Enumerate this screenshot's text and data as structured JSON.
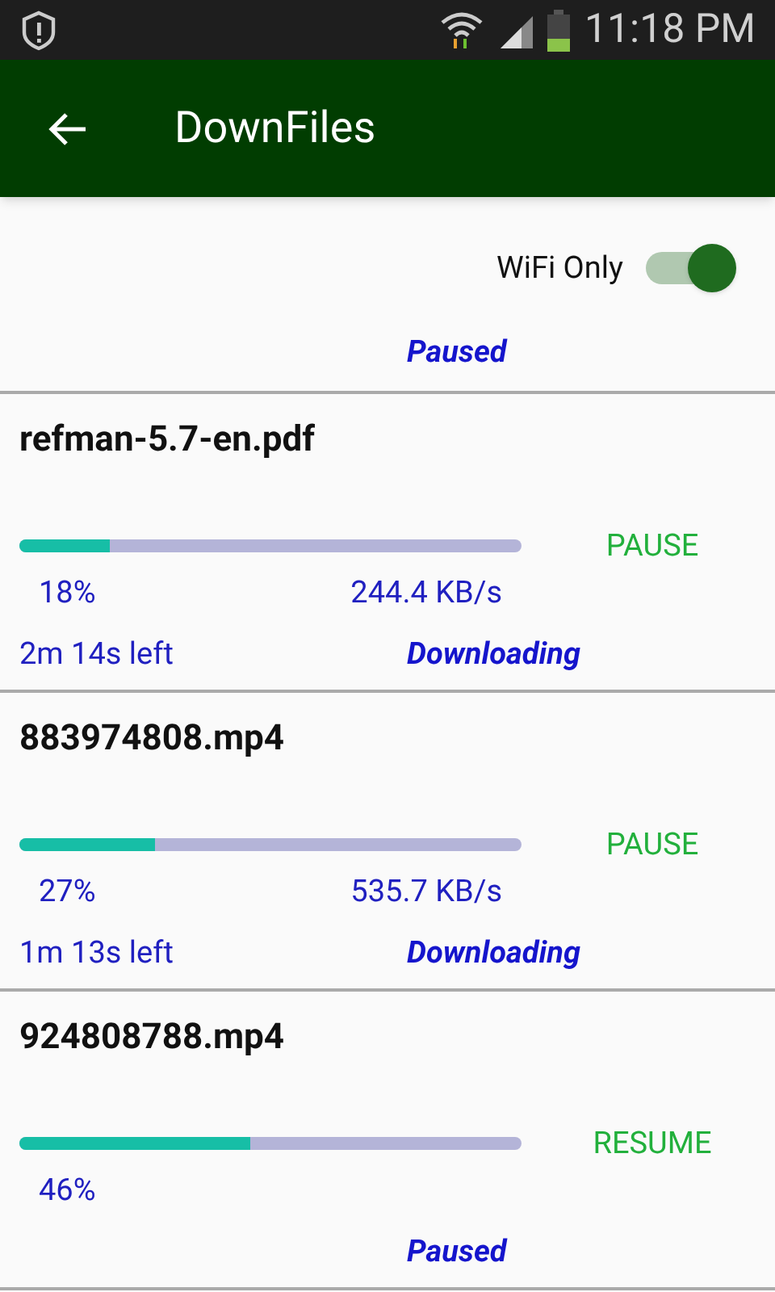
{
  "status_bar": {
    "time": "11:18 PM"
  },
  "app_bar": {
    "title": "DownFiles"
  },
  "wifi_only": {
    "label": "WiFi Only",
    "on": true
  },
  "overall_status": "Paused",
  "downloads": [
    {
      "name": "refman-5.7-en.pdf",
      "level": 0.18,
      "percent": "18%",
      "speed": "244.4 KB/s",
      "time_left": "2m 14s left",
      "status": "Downloading",
      "action": "PAUSE"
    },
    {
      "name": "883974808.mp4",
      "level": 0.27,
      "percent": "27%",
      "speed": "535.7 KB/s",
      "time_left": "1m 13s left",
      "status": "Downloading",
      "action": "PAUSE"
    },
    {
      "name": "924808788.mp4",
      "level": 0.46,
      "percent": "46%",
      "status": "Paused",
      "action": "RESUME"
    }
  ]
}
